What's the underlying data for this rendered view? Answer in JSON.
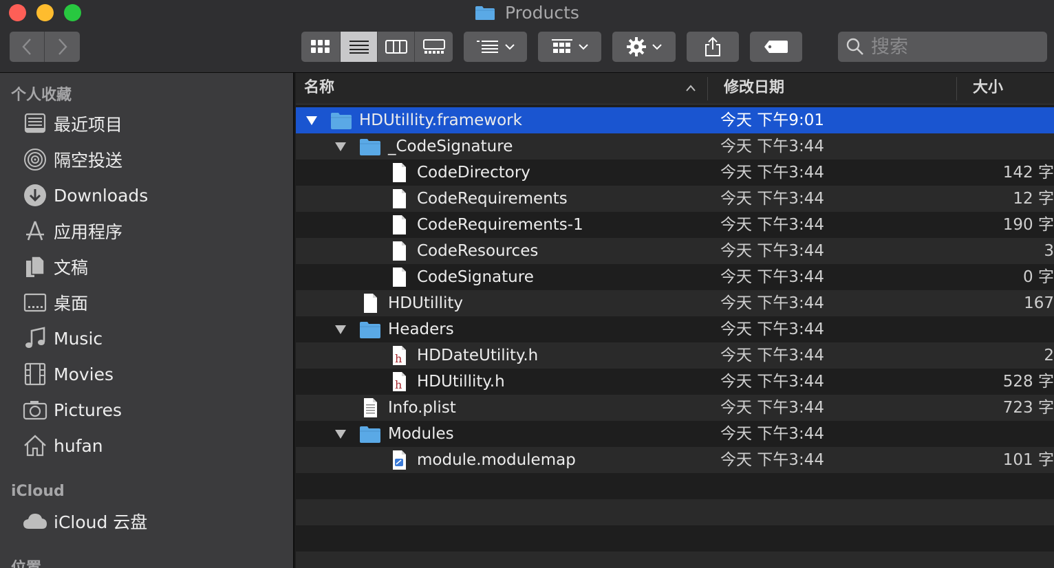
{
  "window": {
    "title": "Products"
  },
  "toolbar": {
    "view_modes": [
      "icon-view",
      "list-view",
      "column-view",
      "gallery-view"
    ],
    "active_view": "list-view",
    "search_placeholder": "搜索"
  },
  "sidebar": {
    "favorites_label": "个人收藏",
    "favorites": [
      {
        "label": "最近项目",
        "icon": "recents-icon"
      },
      {
        "label": "隔空投送",
        "icon": "airdrop-icon"
      },
      {
        "label": "Downloads",
        "icon": "downloads-icon"
      },
      {
        "label": "应用程序",
        "icon": "applications-icon"
      },
      {
        "label": "文稿",
        "icon": "documents-icon"
      },
      {
        "label": "桌面",
        "icon": "desktop-icon"
      },
      {
        "label": "Music",
        "icon": "music-icon"
      },
      {
        "label": "Movies",
        "icon": "movies-icon"
      },
      {
        "label": "Pictures",
        "icon": "pictures-icon"
      },
      {
        "label": "hufan",
        "icon": "home-icon"
      }
    ],
    "icloud_label": "iCloud",
    "icloud": [
      {
        "label": "iCloud 云盘",
        "icon": "cloud-icon"
      }
    ],
    "locations_label": "位置"
  },
  "columns": {
    "name": "名称",
    "date": "修改日期",
    "size": "大小"
  },
  "rows": [
    {
      "name": "HDUtillity.framework",
      "date": "今天 下午9:01",
      "size": "",
      "kind": "folder",
      "expanded": true
    },
    {
      "name": "_CodeSignature",
      "date": "今天 下午3:44",
      "size": "",
      "kind": "folder",
      "expanded": true
    },
    {
      "name": "CodeDirectory",
      "date": "今天 下午3:44",
      "size": "142 字",
      "kind": "file"
    },
    {
      "name": "CodeRequirements",
      "date": "今天 下午3:44",
      "size": "12 字",
      "kind": "file"
    },
    {
      "name": "CodeRequirements-1",
      "date": "今天 下午3:44",
      "size": "190 字",
      "kind": "file"
    },
    {
      "name": "CodeResources",
      "date": "今天 下午3:44",
      "size": "3",
      "kind": "file"
    },
    {
      "name": "CodeSignature",
      "date": "今天 下午3:44",
      "size": "0 字",
      "kind": "file"
    },
    {
      "name": "HDUtillity",
      "date": "今天 下午3:44",
      "size": "167",
      "kind": "file"
    },
    {
      "name": "Headers",
      "date": "今天 下午3:44",
      "size": "",
      "kind": "folder",
      "expanded": true
    },
    {
      "name": "HDDateUtility.h",
      "date": "今天 下午3:44",
      "size": "2",
      "kind": "header"
    },
    {
      "name": "HDUtillity.h",
      "date": "今天 下午3:44",
      "size": "528 字",
      "kind": "header"
    },
    {
      "name": "Info.plist",
      "date": "今天 下午3:44",
      "size": "723 字",
      "kind": "plist"
    },
    {
      "name": "Modules",
      "date": "今天 下午3:44",
      "size": "",
      "kind": "folder",
      "expanded": true
    },
    {
      "name": "module.modulemap",
      "date": "今天 下午3:44",
      "size": "101 字",
      "kind": "modulemap"
    }
  ],
  "colors": {
    "selection": "#1a55d0",
    "folder": "#5aa9e6",
    "close": "#fe5f57",
    "minimize": "#febc2e",
    "maximize": "#28c840"
  }
}
